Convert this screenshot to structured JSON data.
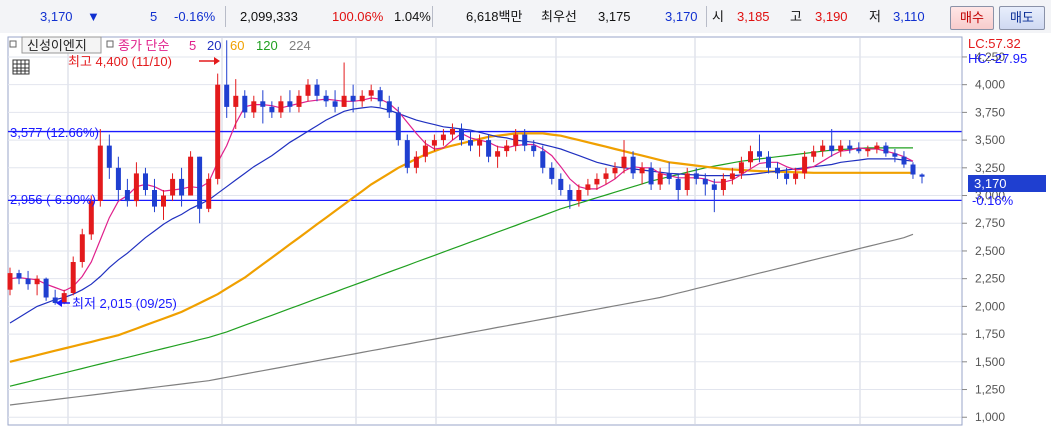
{
  "quote_bar": {
    "price": "3,170",
    "change_arrow": "▼",
    "change": "5",
    "change_pct": "-0.16%",
    "volume": "2,099,333",
    "volume_ratio": "100.06%",
    "turnover": "1.04%",
    "amount": "6,618백만",
    "best_ask_label": "최우선",
    "best_ask": "3,175",
    "best_bid": "3,170",
    "open_label": "시",
    "open": "3,185",
    "high_label": "고",
    "high": "3,190",
    "low_label": "저",
    "low": "3,110",
    "buy_label": "매수",
    "sell_label": "매도"
  },
  "legend": {
    "indicator_label": "신성이엔지",
    "ma_label": "종가 단순",
    "ma_periods": [
      "5",
      "20",
      "60",
      "120",
      "224"
    ],
    "ma_colors": [
      "#e0208c",
      "#2030c0",
      "#f0a000",
      "#20a020",
      "#808080"
    ]
  },
  "right_info": {
    "lc": "LC:57.32",
    "hc": "HC:-27.95",
    "current_price_tag": "3,170",
    "current_pct_tag": "-0.16%"
  },
  "annotations": {
    "high_mark": "최고 4,400 (11/10)",
    "low_mark": "최저 2,015 (09/25)",
    "upper_line_label": "3,577 (12.66%)",
    "lower_line_label": "2,956 (-6.90%)"
  },
  "colors": {
    "up": "#e31a1c",
    "down": "#1f3fd0",
    "ma5": "#e0208c",
    "ma20": "#2030c0",
    "ma60": "#f0a000",
    "ma120": "#20a020",
    "ma224": "#808080",
    "hline": "#1a1aff"
  },
  "chart_data": {
    "type": "candlestick",
    "y_axis_ticks": [
      "4,250",
      "4,000",
      "3,750",
      "3,500",
      "3,250",
      "3,000",
      "2,750",
      "2,500",
      "2,250",
      "2,000",
      "1,750",
      "1,500",
      "1,250",
      "1,000"
    ],
    "y_axis_values": [
      4250,
      4000,
      3750,
      3500,
      3250,
      3000,
      2750,
      2500,
      2250,
      2000,
      1750,
      1500,
      1250,
      1000
    ],
    "ylim": [
      930,
      4430
    ],
    "horizontal_lines": [
      3577,
      2956
    ],
    "ohlc": [
      [
        2150,
        2350,
        2100,
        2300
      ],
      [
        2300,
        2330,
        2200,
        2250
      ],
      [
        2250,
        2320,
        2150,
        2200
      ],
      [
        2200,
        2280,
        2100,
        2250
      ],
      [
        2250,
        2260,
        2050,
        2080
      ],
      [
        2080,
        2150,
        2015,
        2030
      ],
      [
        2030,
        2150,
        2020,
        2120
      ],
      [
        2120,
        2450,
        2100,
        2400
      ],
      [
        2400,
        2700,
        2350,
        2650
      ],
      [
        2650,
        3000,
        2600,
        2950
      ],
      [
        2950,
        3600,
        2900,
        3450
      ],
      [
        3450,
        3550,
        3150,
        3250
      ],
      [
        3250,
        3350,
        2950,
        3050
      ],
      [
        3050,
        3150,
        2900,
        2950
      ],
      [
        2950,
        3300,
        2900,
        3200
      ],
      [
        3200,
        3250,
        3000,
        3050
      ],
      [
        3050,
        3150,
        2850,
        2900
      ],
      [
        2900,
        3050,
        2780,
        3000
      ],
      [
        3000,
        3200,
        2950,
        3150
      ],
      [
        3150,
        3250,
        2900,
        3000
      ],
      [
        3000,
        3400,
        3000,
        3350
      ],
      [
        3350,
        3350,
        2750,
        2880
      ],
      [
        2880,
        3200,
        2850,
        3150
      ],
      [
        3150,
        4100,
        3100,
        4000
      ],
      [
        4000,
        4400,
        3700,
        3800
      ],
      [
        3800,
        4050,
        3600,
        3900
      ],
      [
        3900,
        3950,
        3700,
        3750
      ],
      [
        3750,
        3900,
        3700,
        3850
      ],
      [
        3850,
        3950,
        3650,
        3800
      ],
      [
        3800,
        3850,
        3700,
        3750
      ],
      [
        3750,
        3900,
        3700,
        3850
      ],
      [
        3850,
        3950,
        3750,
        3800
      ],
      [
        3800,
        3950,
        3750,
        3900
      ],
      [
        3900,
        4050,
        3850,
        4000
      ],
      [
        4000,
        4050,
        3850,
        3900
      ],
      [
        3900,
        3950,
        3800,
        3850
      ],
      [
        3850,
        3950,
        3750,
        3800
      ],
      [
        3800,
        4200,
        3800,
        3900
      ],
      [
        3900,
        4000,
        3750,
        3850
      ],
      [
        3850,
        3950,
        3800,
        3900
      ],
      [
        3900,
        4000,
        3850,
        3950
      ],
      [
        3950,
        3980,
        3800,
        3850
      ],
      [
        3850,
        3900,
        3700,
        3750
      ],
      [
        3750,
        3800,
        3450,
        3500
      ],
      [
        3500,
        3550,
        3200,
        3250
      ],
      [
        3250,
        3400,
        3200,
        3350
      ],
      [
        3350,
        3500,
        3300,
        3450
      ],
      [
        3450,
        3550,
        3400,
        3500
      ],
      [
        3500,
        3600,
        3450,
        3550
      ],
      [
        3550,
        3650,
        3500,
        3600
      ],
      [
        3600,
        3650,
        3450,
        3500
      ],
      [
        3500,
        3580,
        3400,
        3450
      ],
      [
        3450,
        3550,
        3350,
        3500
      ],
      [
        3500,
        3550,
        3300,
        3350
      ],
      [
        3350,
        3450,
        3250,
        3400
      ],
      [
        3400,
        3500,
        3350,
        3450
      ],
      [
        3450,
        3600,
        3400,
        3550
      ],
      [
        3550,
        3600,
        3400,
        3450
      ],
      [
        3450,
        3500,
        3350,
        3400
      ],
      [
        3400,
        3450,
        3200,
        3250
      ],
      [
        3250,
        3300,
        3100,
        3150
      ],
      [
        3150,
        3200,
        3000,
        3050
      ],
      [
        3050,
        3100,
        2880,
        2950
      ],
      [
        2950,
        3100,
        2900,
        3050
      ],
      [
        3050,
        3150,
        3000,
        3100
      ],
      [
        3100,
        3200,
        3050,
        3150
      ],
      [
        3150,
        3250,
        3100,
        3200
      ],
      [
        3200,
        3300,
        3150,
        3250
      ],
      [
        3250,
        3500,
        3200,
        3350
      ],
      [
        3350,
        3400,
        3150,
        3200
      ],
      [
        3200,
        3300,
        3100,
        3250
      ],
      [
        3250,
        3300,
        3050,
        3100
      ],
      [
        3100,
        3250,
        3050,
        3200
      ],
      [
        3200,
        3300,
        3100,
        3150
      ],
      [
        3150,
        3200,
        2950,
        3050
      ],
      [
        3050,
        3250,
        3000,
        3200
      ],
      [
        3200,
        3250,
        3100,
        3150
      ],
      [
        3150,
        3200,
        3000,
        3100
      ],
      [
        3100,
        3150,
        2850,
        3050
      ],
      [
        3050,
        3200,
        3000,
        3150
      ],
      [
        3150,
        3250,
        3100,
        3200
      ],
      [
        3200,
        3350,
        3150,
        3300
      ],
      [
        3300,
        3450,
        3250,
        3400
      ],
      [
        3400,
        3550,
        3300,
        3350
      ],
      [
        3350,
        3400,
        3200,
        3250
      ],
      [
        3250,
        3300,
        3150,
        3200
      ],
      [
        3200,
        3250,
        3100,
        3150
      ],
      [
        3150,
        3250,
        3100,
        3200
      ],
      [
        3200,
        3400,
        3150,
        3350
      ],
      [
        3350,
        3450,
        3300,
        3400
      ],
      [
        3400,
        3500,
        3350,
        3450
      ],
      [
        3450,
        3600,
        3350,
        3400
      ],
      [
        3400,
        3500,
        3350,
        3450
      ],
      [
        3450,
        3500,
        3380,
        3420
      ],
      [
        3420,
        3480,
        3380,
        3400
      ],
      [
        3400,
        3450,
        3350,
        3420
      ],
      [
        3420,
        3480,
        3380,
        3450
      ],
      [
        3450,
        3480,
        3350,
        3380
      ],
      [
        3380,
        3420,
        3300,
        3350
      ],
      [
        3350,
        3400,
        3250,
        3280
      ],
      [
        3280,
        3300,
        3150,
        3190
      ],
      [
        3190,
        3200,
        3110,
        3170
      ]
    ],
    "ma_series": [
      {
        "name": "5",
        "values": [
          2250,
          2260,
          2250,
          2240,
          2200,
          2170,
          2140,
          2180,
          2270,
          2400,
          2600,
          2800,
          2950,
          3000,
          3080,
          3100,
          3080,
          3040,
          3050,
          3060,
          3080,
          3070,
          3120,
          3300,
          3450,
          3650,
          3800,
          3820,
          3820,
          3810,
          3790,
          3810,
          3830,
          3850,
          3860,
          3870,
          3860,
          3850,
          3850,
          3860,
          3880,
          3870,
          3830,
          3760,
          3660,
          3560,
          3470,
          3420,
          3430,
          3500,
          3560,
          3520,
          3500,
          3480,
          3440,
          3430,
          3450,
          3460,
          3460,
          3420,
          3360,
          3260,
          3150,
          3080,
          3060,
          3060,
          3100,
          3150,
          3220,
          3260,
          3250,
          3250,
          3200,
          3180,
          3160,
          3160,
          3160,
          3150,
          3120,
          3120,
          3140,
          3190,
          3240,
          3290,
          3300,
          3300,
          3260,
          3230,
          3240,
          3260,
          3310,
          3360,
          3400,
          3410,
          3430,
          3420,
          3420,
          3400,
          3380,
          3350,
          3310
        ]
      },
      {
        "name": "20",
        "values": [
          1850,
          1900,
          1950,
          2000,
          2030,
          2060,
          2080,
          2110,
          2150,
          2200,
          2270,
          2350,
          2420,
          2480,
          2550,
          2620,
          2680,
          2740,
          2790,
          2830,
          2880,
          2920,
          2960,
          3020,
          3080,
          3140,
          3200,
          3260,
          3310,
          3360,
          3420,
          3480,
          3530,
          3580,
          3630,
          3680,
          3720,
          3760,
          3780,
          3790,
          3800,
          3790,
          3770,
          3740,
          3710,
          3680,
          3660,
          3640,
          3620,
          3610,
          3600,
          3590,
          3570,
          3550,
          3530,
          3520,
          3500,
          3490,
          3480,
          3460,
          3440,
          3420,
          3390,
          3360,
          3330,
          3300,
          3280,
          3260,
          3250,
          3240,
          3230,
          3220,
          3210,
          3200,
          3195,
          3190,
          3185,
          3180,
          3180,
          3180,
          3180,
          3185,
          3190,
          3200,
          3210,
          3220,
          3230,
          3240,
          3250,
          3260,
          3270,
          3280,
          3300,
          3310,
          3320,
          3330,
          3330,
          3330,
          3330,
          3320,
          3310
        ]
      },
      {
        "name": "60",
        "values": [
          1500,
          1520,
          1540,
          1560,
          1580,
          1600,
          1620,
          1640,
          1660,
          1680,
          1700,
          1720,
          1740,
          1770,
          1800,
          1830,
          1860,
          1890,
          1920,
          1950,
          1990,
          2030,
          2070,
          2110,
          2160,
          2210,
          2260,
          2320,
          2380,
          2440,
          2500,
          2560,
          2620,
          2680,
          2740,
          2800,
          2860,
          2920,
          2980,
          3040,
          3100,
          3150,
          3200,
          3250,
          3290,
          3330,
          3370,
          3400,
          3430,
          3450,
          3470,
          3490,
          3510,
          3530,
          3540,
          3550,
          3560,
          3560,
          3560,
          3560,
          3550,
          3540,
          3520,
          3500,
          3480,
          3460,
          3440,
          3420,
          3400,
          3380,
          3360,
          3340,
          3320,
          3300,
          3290,
          3280,
          3270,
          3260,
          3250,
          3240,
          3235,
          3230,
          3225,
          3220,
          3218,
          3215,
          3212,
          3210,
          3208,
          3205,
          3205,
          3205,
          3205,
          3205,
          3205,
          3205,
          3205,
          3205,
          3205,
          3205,
          3205
        ]
      },
      {
        "name": "120",
        "values": [
          1280,
          1300,
          1320,
          1340,
          1360,
          1380,
          1400,
          1420,
          1440,
          1460,
          1480,
          1500,
          1520,
          1540,
          1560,
          1580,
          1600,
          1620,
          1640,
          1660,
          1680,
          1700,
          1720,
          1745,
          1770,
          1800,
          1830,
          1860,
          1890,
          1920,
          1950,
          1980,
          2010,
          2040,
          2070,
          2100,
          2130,
          2160,
          2190,
          2220,
          2250,
          2280,
          2310,
          2340,
          2370,
          2400,
          2430,
          2460,
          2490,
          2520,
          2550,
          2580,
          2610,
          2640,
          2670,
          2700,
          2730,
          2760,
          2790,
          2820,
          2850,
          2880,
          2905,
          2930,
          2955,
          2980,
          3005,
          3030,
          3055,
          3080,
          3105,
          3130,
          3150,
          3170,
          3190,
          3210,
          3230,
          3250,
          3265,
          3280,
          3295,
          3310,
          3320,
          3330,
          3340,
          3350,
          3360,
          3370,
          3380,
          3390,
          3400,
          3410,
          3415,
          3420,
          3425,
          3430,
          3430,
          3430,
          3430,
          3430,
          3430
        ]
      },
      {
        "name": "224",
        "values": [
          1110,
          1120,
          1130,
          1140,
          1150,
          1160,
          1170,
          1180,
          1190,
          1200,
          1210,
          1220,
          1230,
          1240,
          1250,
          1260,
          1270,
          1280,
          1290,
          1300,
          1310,
          1320,
          1330,
          1345,
          1360,
          1375,
          1390,
          1405,
          1420,
          1435,
          1450,
          1465,
          1480,
          1495,
          1510,
          1525,
          1540,
          1555,
          1570,
          1585,
          1600,
          1615,
          1630,
          1645,
          1660,
          1675,
          1690,
          1705,
          1720,
          1735,
          1750,
          1765,
          1780,
          1795,
          1810,
          1825,
          1840,
          1855,
          1870,
          1885,
          1900,
          1915,
          1930,
          1945,
          1960,
          1975,
          1990,
          2005,
          2020,
          2035,
          2050,
          2065,
          2080,
          2100,
          2120,
          2140,
          2160,
          2180,
          2200,
          2220,
          2240,
          2260,
          2280,
          2300,
          2320,
          2340,
          2360,
          2380,
          2400,
          2420,
          2440,
          2460,
          2480,
          2500,
          2520,
          2540,
          2560,
          2580,
          2600,
          2620,
          2650
        ]
      }
    ]
  }
}
